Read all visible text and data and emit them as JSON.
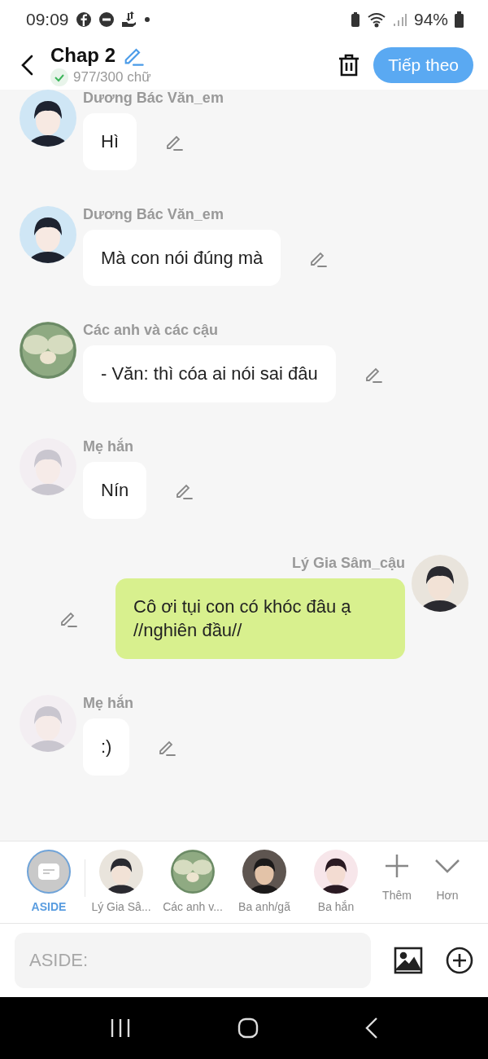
{
  "status_bar": {
    "time": "09:09",
    "battery": "94%"
  },
  "header": {
    "title": "Chap 2",
    "word_count": "977/300 chữ",
    "next_button": "Tiếp theo"
  },
  "messages": [
    {
      "kind": "incoming",
      "sender": "Dương Bác Văn_em",
      "text": "Hì"
    },
    {
      "kind": "incoming",
      "sender": "Dương Bác Văn_em",
      "text": "Mà con nói đúng mà"
    },
    {
      "kind": "incoming",
      "sender": "Các anh và các cậu",
      "text": "- Văn: thì cóa ai nói sai đâu"
    },
    {
      "kind": "incoming",
      "sender": "Mẹ hắn",
      "text": "Nín"
    },
    {
      "kind": "outgoing",
      "sender": "Lý Gia Sâm_cậu",
      "text": "Cô ơi tụi con có khóc đâu ạ //nghiên đầu//"
    },
    {
      "kind": "incoming",
      "sender": "Mẹ hắn",
      "text": ":)"
    }
  ],
  "characters": [
    {
      "kind": "aside",
      "label": "ASIDE",
      "selected": true
    },
    {
      "kind": "character",
      "label": "Lý Gia Sâ...",
      "selected": false
    },
    {
      "kind": "character",
      "label": "Các anh v...",
      "selected": false
    },
    {
      "kind": "character",
      "label": "Ba anh/gã",
      "selected": false
    },
    {
      "kind": "character",
      "label": "Ba hắn",
      "selected": false
    },
    {
      "kind": "add",
      "label": "Thêm"
    },
    {
      "kind": "more",
      "label": "Hơn"
    }
  ],
  "input": {
    "placeholder": "ASIDE:"
  }
}
